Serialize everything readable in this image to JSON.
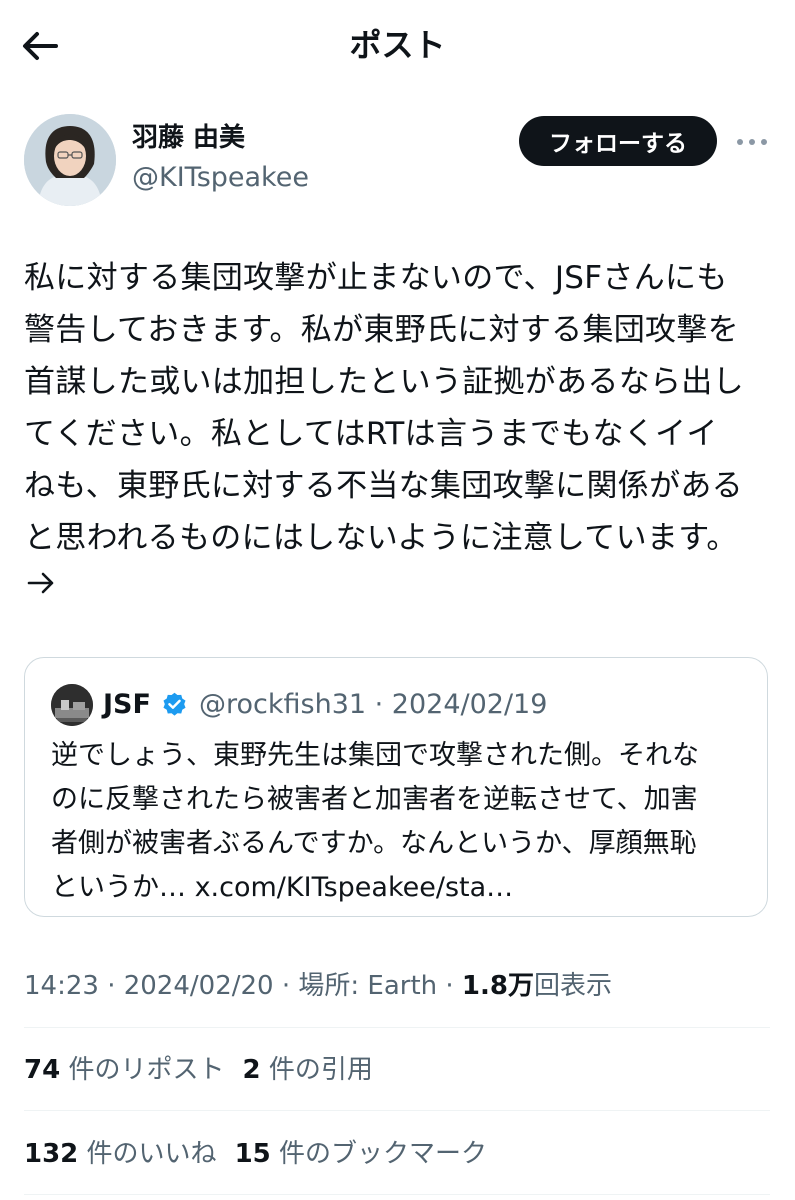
{
  "header": {
    "title": "ポスト"
  },
  "author": {
    "name": "羽藤 由美",
    "handle": "@KITspeakee",
    "follow_label": "フォローする"
  },
  "tweet": {
    "text": "私に対する集団攻撃が止まないので、JSFさんにも\n警告しておきます。私が東野氏に対する集団攻撃を\n首謀した或いは加担したという証拠があるなら出し\nてください。私としてはRTは言うまでもなくイイ\nねも、東野氏に対する不当な集団攻撃に関係がある\nと思われるものにはしないように注意しています。",
    "continue_glyph": "→"
  },
  "quote": {
    "name": "JSF",
    "handle_date": "@rockfish31 · 2024/02/19",
    "text": "逆でしょう、東野先生は集団で攻撃された側。それな\nのに反撃されたら被害者と加害者を逆転させて、加害\n者側が被害者ぶるんですか。なんというか、厚顔無恥\nというか… x.com/KITspeakee/sta…"
  },
  "meta": {
    "time_date": "14:23 · 2024/02/20",
    "location": "場所: Earth",
    "sep": " · ",
    "views_count": "1.8万",
    "views_label": "回表示"
  },
  "stats": {
    "reposts_count": "74",
    "reposts_label": "件のリポスト",
    "quotes_count": "2",
    "quotes_label": "件の引用",
    "likes_count": "132",
    "likes_label": "件のいいね",
    "bookmarks_count": "15",
    "bookmarks_label": "件のブックマーク"
  },
  "colors": {
    "text_primary": "#0f1419",
    "text_secondary": "#536471",
    "verified_blue": "#1d9bf0",
    "border": "#cfd9de",
    "follow_bg": "#0f1419"
  },
  "icons": {
    "back": "arrow-left-icon",
    "more": "ellipsis-icon",
    "verified": "verified-badge-icon",
    "continue": "arrow-right-icon"
  }
}
